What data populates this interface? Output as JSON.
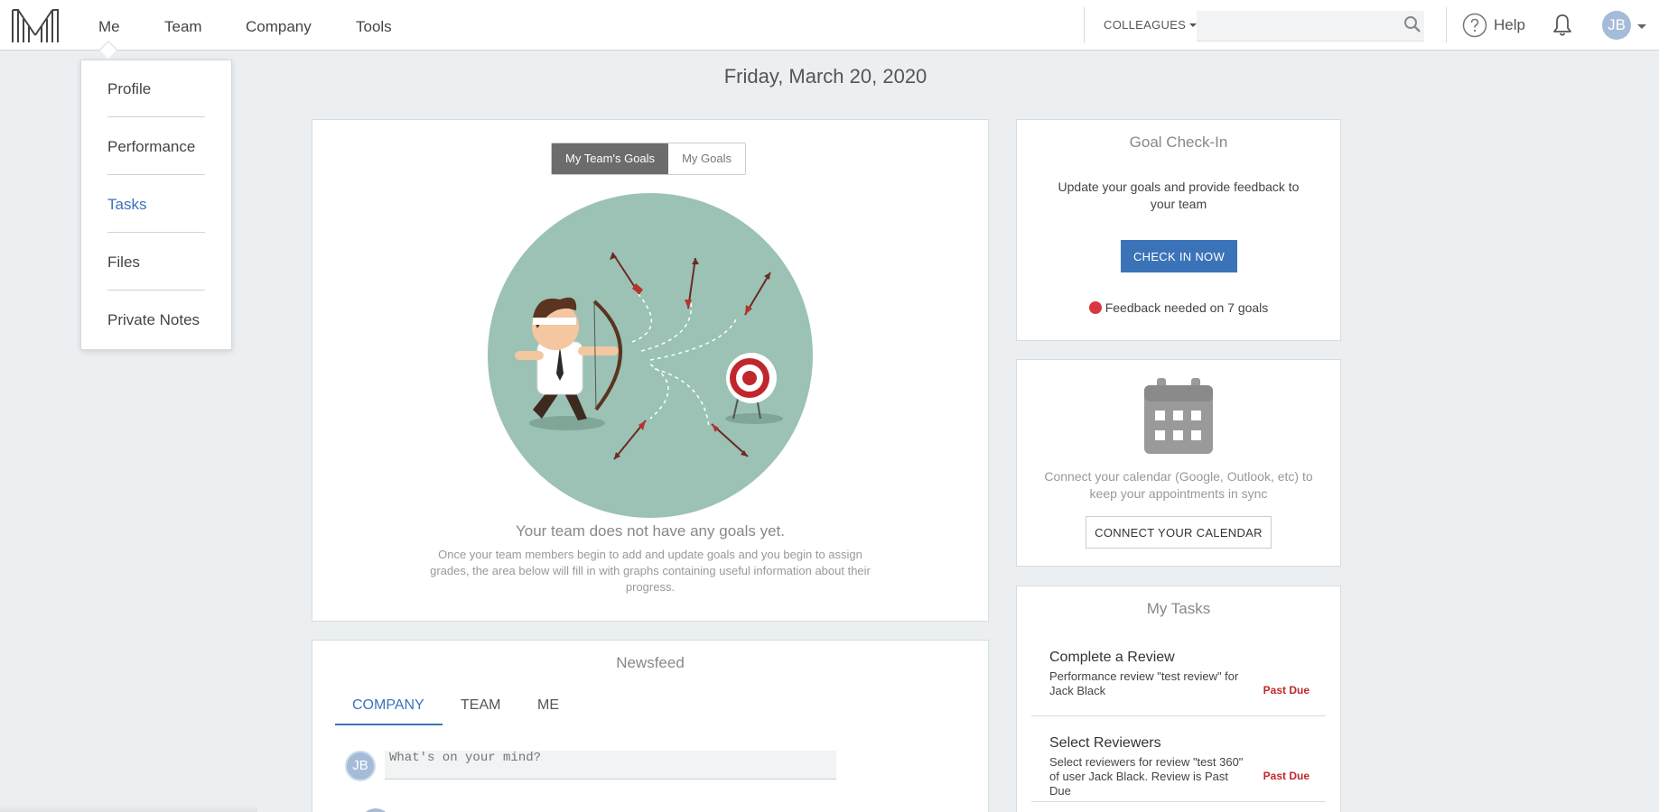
{
  "nav": {
    "items": [
      "Me",
      "Team",
      "Company",
      "Tools"
    ],
    "colleagues_label": "COLLEAGUES",
    "search_placeholder": "",
    "help_label": "Help",
    "avatar_initials": "JB"
  },
  "dropdown": {
    "items": [
      "Profile",
      "Performance",
      "Tasks",
      "Files",
      "Private Notes"
    ],
    "active_item": "Tasks"
  },
  "date": "Friday, March 20, 2020",
  "goals": {
    "toggle_active": "My Team's Goals",
    "toggle_inactive": "My Goals",
    "heading": "Your team does not have any goals yet.",
    "description": "Once your team members begin to add and update goals and you begin to assign grades, the area below will fill in with graphs containing useful information about their progress."
  },
  "newsfeed": {
    "title": "Newsfeed",
    "tabs": [
      "COMPANY",
      "TEAM",
      "ME"
    ],
    "active_tab": "COMPANY",
    "avatar_initials": "JB",
    "input_placeholder": "What's on your mind?"
  },
  "checkin": {
    "title": "Goal Check-In",
    "text": "Update your goals and provide feedback to your team",
    "button_label": "CHECK IN NOW",
    "status": "Feedback needed on 7 goals"
  },
  "calendar": {
    "text": "Connect your calendar (Google, Outlook, etc) to keep your appointments in sync",
    "button_label": "CONNECT YOUR CALENDAR"
  },
  "tasks": {
    "title": "My Tasks",
    "items": [
      {
        "title": "Complete a Review",
        "description": "Performance review \"test review\" for Jack Black",
        "status": "Past Due"
      },
      {
        "title": "Select Reviewers",
        "description": "Select reviewers for review \"test 360\" of user Jack Black. Review is Past Due",
        "status": "Past Due"
      }
    ]
  },
  "colors": {
    "accent": "#3b73b9",
    "alert": "#d8393f",
    "past_due": "#c0272d",
    "illustration_bg": "#9bc2b4"
  }
}
